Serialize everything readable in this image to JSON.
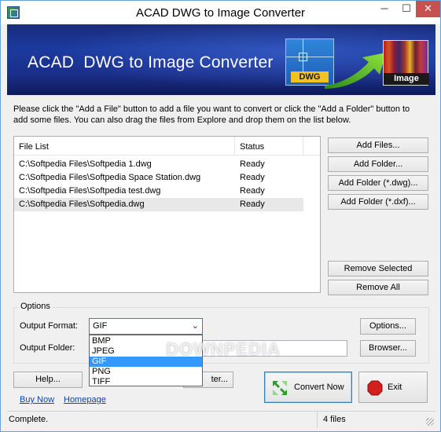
{
  "window": {
    "title": "ACAD DWG to Image Converter",
    "minimize": "─",
    "maximize": "☐",
    "close": "✕"
  },
  "banner": {
    "title": "ACAD  DWG to Image Converter",
    "dwg_label": "DWG",
    "image_label": "Image"
  },
  "instructions": "Please click the \"Add a File\" button to add a file you want to convert or click the \"Add a Folder\" button to add some files. You can also drag the files from Explore and drop them on the list below.",
  "file_list": {
    "headers": [
      "File List",
      "Status"
    ],
    "rows": [
      {
        "file": "C:\\Softpedia Files\\Softpedia 1.dwg",
        "status": "Ready"
      },
      {
        "file": "C:\\Softpedia Files\\Softpedia Space Station.dwg",
        "status": "Ready"
      },
      {
        "file": "C:\\Softpedia Files\\Softpedia test.dwg",
        "status": "Ready"
      },
      {
        "file": "C:\\Softpedia Files\\Softpedia.dwg",
        "status": "Ready"
      }
    ]
  },
  "side_buttons": {
    "add_files": "Add Files...",
    "add_folder": "Add Folder...",
    "add_folder_dwg": "Add Folder (*.dwg)...",
    "add_folder_dxf": "Add Folder (*.dxf)...",
    "remove_selected": "Remove Selected",
    "remove_all": "Remove All"
  },
  "options": {
    "group_label": "Options",
    "output_format_label": "Output Format:",
    "output_format_value": "GIF",
    "output_folder_label": "Output Folder:",
    "output_folder_value": "",
    "options_button": "Options...",
    "browse_button": "Browser...",
    "format_options": [
      "BMP",
      "JPEG",
      "GIF",
      "PNG",
      "TIFF"
    ],
    "watermark": "DOWNPEDIA"
  },
  "bottom": {
    "help_button": "Help...",
    "hidden_button_tail": "ter...",
    "buy_now": "Buy Now",
    "homepage": "Homepage",
    "convert_now": "Convert Now",
    "exit": "Exit"
  },
  "status_bar": {
    "left": "Complete.",
    "right": "4 files"
  }
}
